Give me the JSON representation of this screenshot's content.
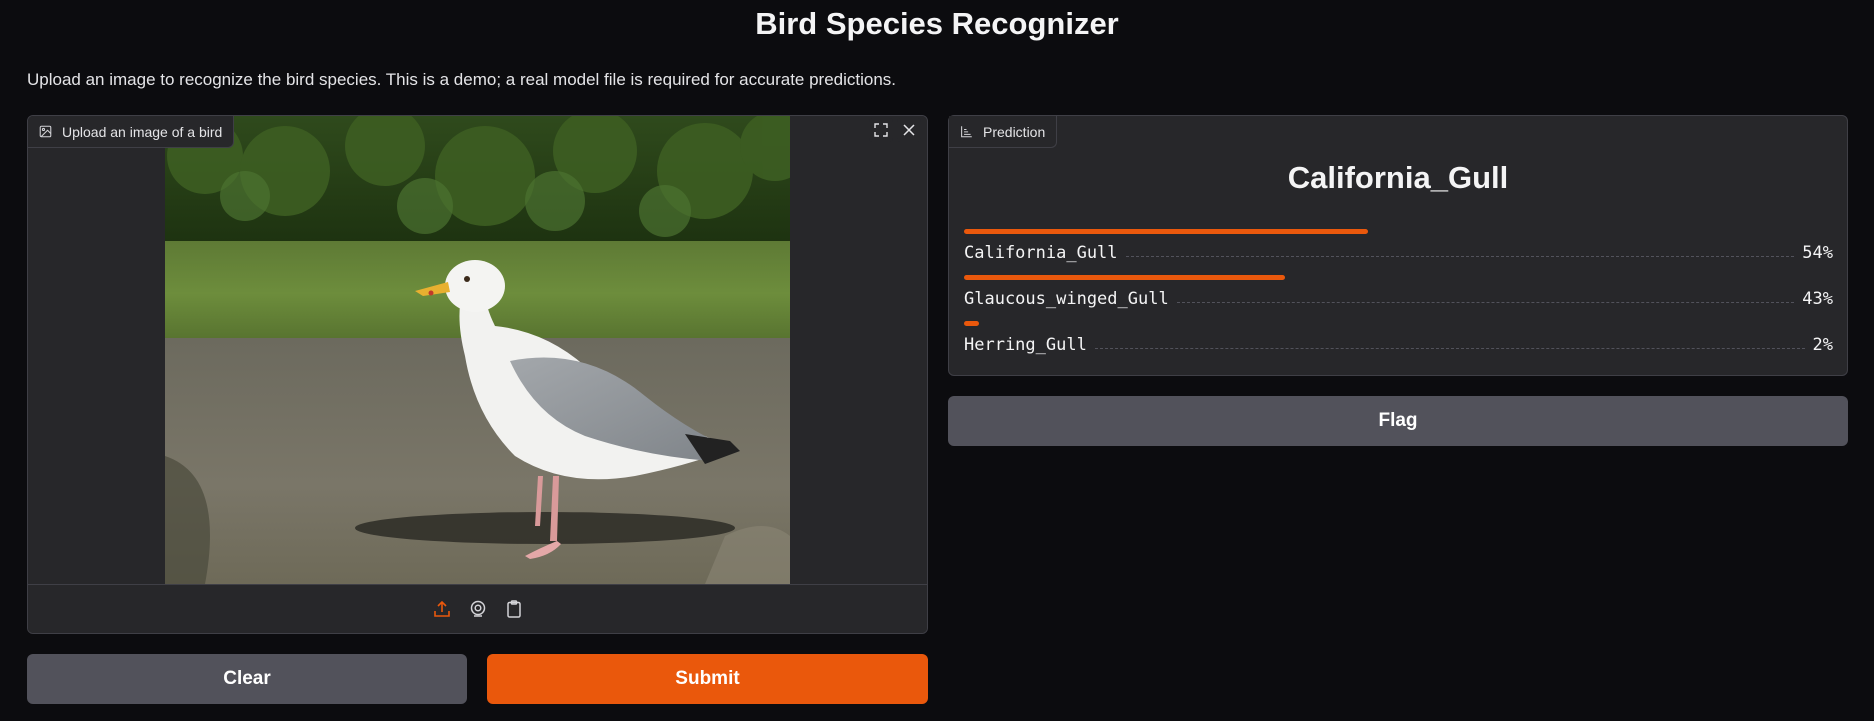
{
  "app": {
    "title": "Bird Species Recognizer",
    "description": "Upload an image to recognize the bird species. This is a demo; a real model file is required for accurate predictions."
  },
  "image_input": {
    "label": "Upload an image of a bird",
    "tools": [
      "fullscreen-icon",
      "close-icon"
    ],
    "sources": [
      "upload-icon",
      "webcam-icon",
      "clipboard-icon"
    ]
  },
  "buttons": {
    "clear": "Clear",
    "submit": "Submit",
    "flag": "Flag"
  },
  "prediction": {
    "label": "Prediction",
    "top_class": "California_Gull",
    "confidences": [
      {
        "name": "California_Gull",
        "percent": "54%",
        "value": 0.54
      },
      {
        "name": "Glaucous_winged_Gull",
        "percent": "43%",
        "value": 0.43
      },
      {
        "name": "Herring_Gull",
        "percent": "2%",
        "value": 0.02
      }
    ]
  },
  "colors": {
    "accent": "#ea580c",
    "background": "#0c0c0f",
    "panel": "#27272a",
    "secondary_button": "#52525b"
  }
}
